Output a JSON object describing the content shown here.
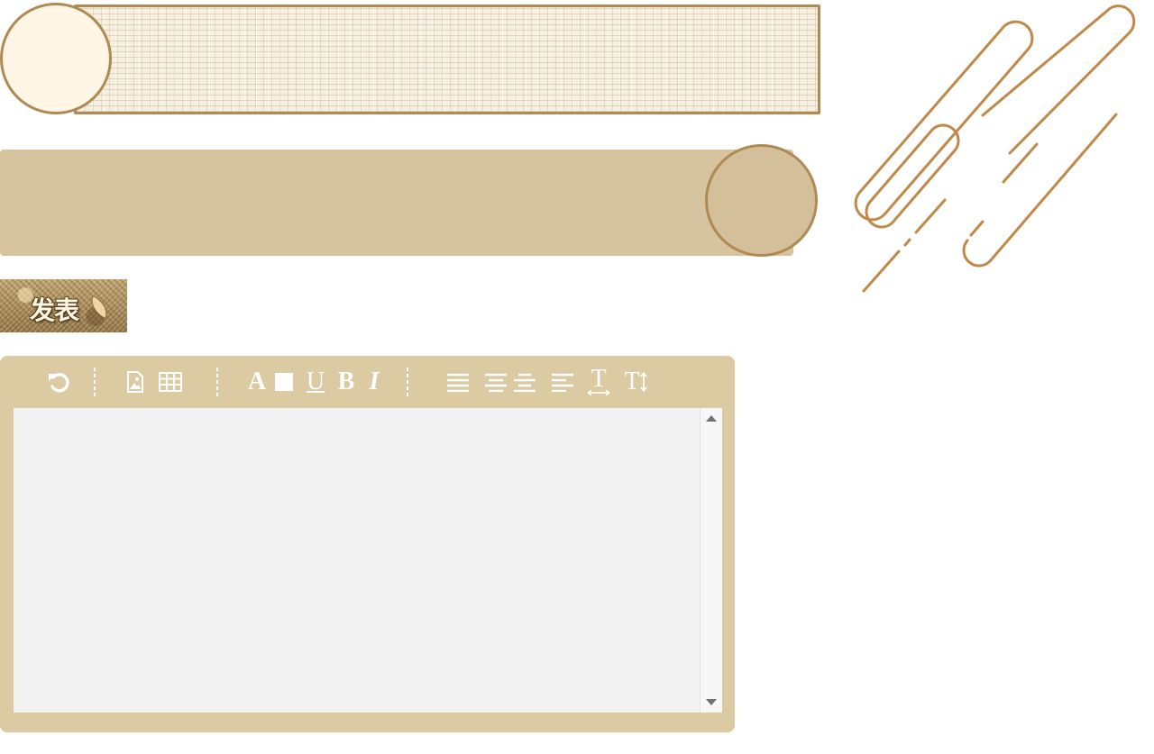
{
  "publish": {
    "label": "发表"
  },
  "colors": {
    "accent": "#b08a52",
    "banner_fill": "#d6c4a0",
    "editor_frame": "#dccaa3",
    "editor_bg": "#f2f2f2",
    "stripe": "#c0894a"
  },
  "toolbar": {
    "items": [
      {
        "name": "undo-icon"
      },
      {
        "name": "image-icon"
      },
      {
        "name": "table-icon"
      },
      {
        "name": "font-color-icon",
        "label": "A"
      },
      {
        "name": "background-color-icon"
      },
      {
        "name": "underline-icon",
        "label": "U"
      },
      {
        "name": "bold-icon",
        "label": "B"
      },
      {
        "name": "italic-icon",
        "label": "I"
      },
      {
        "name": "align-justify-icon"
      },
      {
        "name": "align-center-icon"
      },
      {
        "name": "align-center-alt-icon"
      },
      {
        "name": "align-left-icon"
      },
      {
        "name": "line-height-icon",
        "label": "T"
      },
      {
        "name": "font-size-icon",
        "label": "T"
      }
    ]
  },
  "editor": {
    "content": ""
  }
}
